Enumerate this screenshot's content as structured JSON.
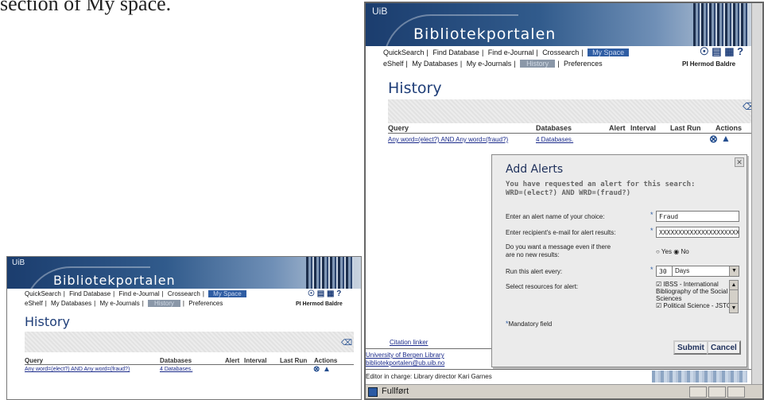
{
  "caption": "section of My space.",
  "portal": {
    "logo": "UiB",
    "title": "Bibliotekportalen",
    "nav_main": [
      "QuickSearch",
      "Find Database",
      "Find e-Journal",
      "Crossearch",
      "My Space"
    ],
    "nav_sub": [
      "eShelf",
      "My Databases",
      "My e-Journals",
      "History",
      "Preferences"
    ],
    "user": "PI Hermod Baldre",
    "icons": [
      "globe-icon",
      "library-icon",
      "building-icon",
      "help-icon"
    ]
  },
  "history": {
    "title": "History",
    "columns": [
      "Query",
      "Databases",
      "Alert",
      "Interval",
      "Last Run",
      "Actions"
    ],
    "rows": [
      {
        "query": "Any word=(elect?) AND Any word=(fraud?)",
        "databases": "4 Databases."
      }
    ]
  },
  "small_window": {
    "nav_main": [
      "QuickSearch",
      "Find Database",
      "Find e-Journal",
      "Crossearch",
      "My Space"
    ]
  },
  "dialog": {
    "title": "Add Alerts",
    "info_line1": "You have requested an alert for this search:",
    "info_line2": "WRD=(elect?) AND WRD=(fraud?)",
    "name_label": "Enter an alert name of your choice:",
    "name_value": "Fraud",
    "email_label": "Enter recipient's e-mail for alert results:",
    "email_value": "XXXXXXXXXXXXXXXXXXXXX",
    "message_label_1": "Do you want a message even if there",
    "message_label_2": "are no new results:",
    "yes_label": "Yes",
    "no_label": "No",
    "run_label": "Run this alert every:",
    "run_value": "30",
    "run_unit": "Days",
    "resources_label": "Select resources for alert:",
    "resources": [
      {
        "label": "IBSS - International Bibliography of the Social Sciences",
        "checked": true
      },
      {
        "label": "Political Science - JSTOR",
        "checked": true
      }
    ],
    "mandatory": "Mandatory field",
    "submit": "Submit",
    "cancel": "Cancel"
  },
  "footer": {
    "citation_linker": "Citation linker",
    "library_name": "University of Bergen Library",
    "email": "bibliotekportalen@ub.uib.no",
    "editor": "Editor in charge: Library director Kari Garnes"
  },
  "status_bar": {
    "text": "Fullført"
  },
  "colors": {
    "accent": "#2f5da3",
    "title": "#1f3e78",
    "link": "#1a2a8a"
  }
}
